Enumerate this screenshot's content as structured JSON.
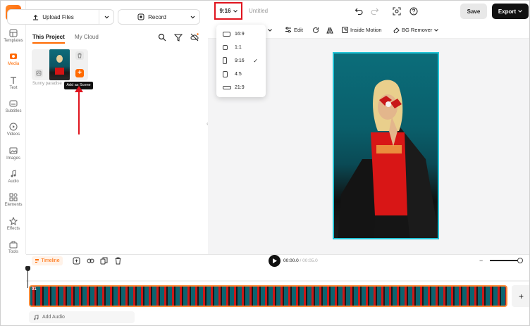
{
  "app": {
    "logo_letter": "F",
    "accent_color": "#ff6a00"
  },
  "rail": {
    "items": [
      {
        "label": "Templates",
        "icon": "templates-icon"
      },
      {
        "label": "Media",
        "icon": "media-icon",
        "active": true
      },
      {
        "label": "Text",
        "icon": "text-icon"
      },
      {
        "label": "Subtitles",
        "icon": "subtitles-icon"
      },
      {
        "label": "Videos",
        "icon": "videos-icon"
      },
      {
        "label": "Images",
        "icon": "images-icon"
      },
      {
        "label": "Audio",
        "icon": "audio-icon"
      },
      {
        "label": "Elements",
        "icon": "elements-icon"
      },
      {
        "label": "Effects",
        "icon": "effects-icon"
      },
      {
        "label": "Tools",
        "icon": "tools-icon"
      }
    ]
  },
  "media_panel": {
    "upload_label": "Upload Files",
    "record_label": "Record",
    "tabs": [
      "This Project",
      "My Cloud"
    ],
    "asset_caption": "Sunny paradise",
    "tooltip": "Add as Scene",
    "add_button_glyph": "+"
  },
  "header": {
    "ratio": "9:16",
    "title": "Untitled",
    "save_label": "Save",
    "export_label": "Export"
  },
  "toolbar": {
    "partial": "s",
    "edit_label": "Edit",
    "inside_motion_label": "Inside Motion",
    "bg_remover_label": "BG Remover"
  },
  "ratio_menu": {
    "options": [
      {
        "label": "16:9",
        "selected": false
      },
      {
        "label": "1:1",
        "selected": false
      },
      {
        "label": "9:16",
        "selected": true
      },
      {
        "label": "4:5",
        "selected": false
      },
      {
        "label": "21:9",
        "selected": false
      }
    ],
    "check_glyph": "✓"
  },
  "timeline": {
    "tab_label": "Timeline",
    "current_time": "00:00.0",
    "separator": " / ",
    "total_time": "00:05.0",
    "clip_label": "01",
    "add_audio_label": "Add Audio",
    "add_track_glyph": "+",
    "zoom_minus": "−"
  }
}
